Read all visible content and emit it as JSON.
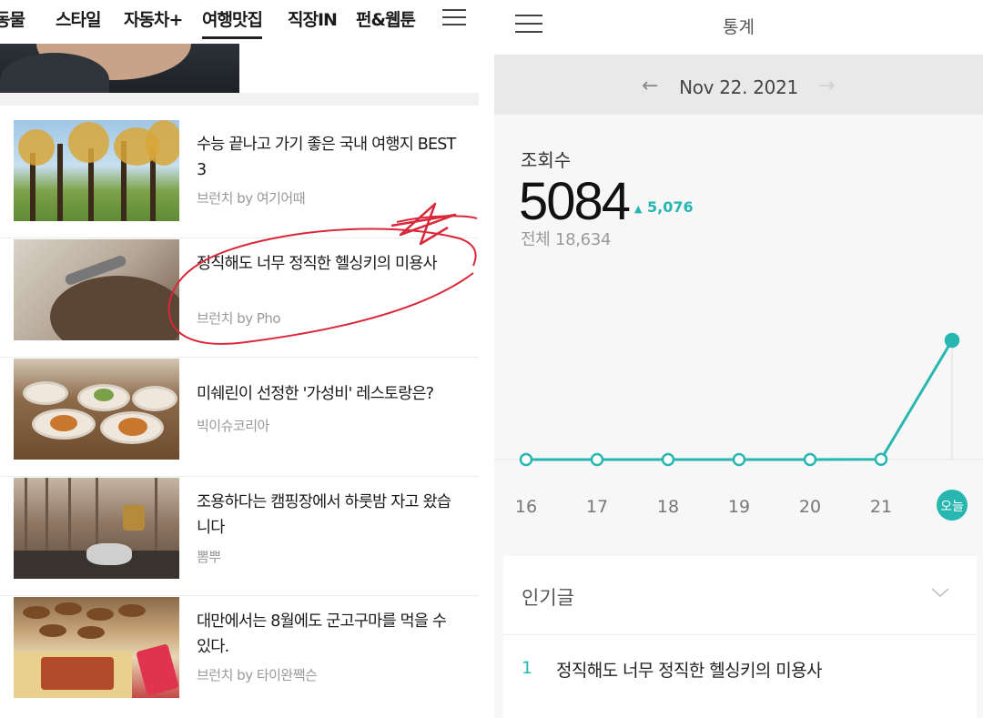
{
  "left": {
    "categories": [
      "동물",
      "스타일",
      "자동차+",
      "여행맛집",
      "직장IN",
      "펀&웹툰"
    ],
    "active_category": "여행맛집",
    "articles": [
      {
        "title": "수능 끝나고 가기 좋은 국내 여행지 BEST 3",
        "source": "브런치 by 여기어때"
      },
      {
        "title": "정직해도 너무 정직한 헬싱키의 미용사",
        "source": "브런치 by Pho"
      },
      {
        "title": "미쉐린이 선정한 '가성비' 레스토랑은?",
        "source": "빅이슈코리아"
      },
      {
        "title": "조용하다는 캠핑장에서 하룻밤 자고 왔습니다",
        "source": "뽐뿌"
      },
      {
        "title": "대만에서는 8월에도 군고구마를 먹을 수 있다.",
        "source": "브런치 by 타이완짹슨"
      }
    ]
  },
  "right": {
    "header_title": "통계",
    "date": "Nov 22. 2021",
    "views_label": "조회수",
    "views_today": "5084",
    "views_delta": "5,076",
    "views_total": "전체 18,634",
    "popular_label": "인기글",
    "popular_items": [
      {
        "rank": "1",
        "title": "정직해도 너무 정직한 헬싱키의 미용사"
      }
    ]
  },
  "colors": {
    "accent": "#27b6b0",
    "annotation": "#d8283a"
  },
  "chart_data": {
    "type": "line",
    "categories": [
      "16",
      "17",
      "18",
      "19",
      "20",
      "21",
      "오늘"
    ],
    "values": [
      0,
      0,
      0,
      0,
      0,
      8,
      5084
    ],
    "highlight_category": "오늘"
  }
}
